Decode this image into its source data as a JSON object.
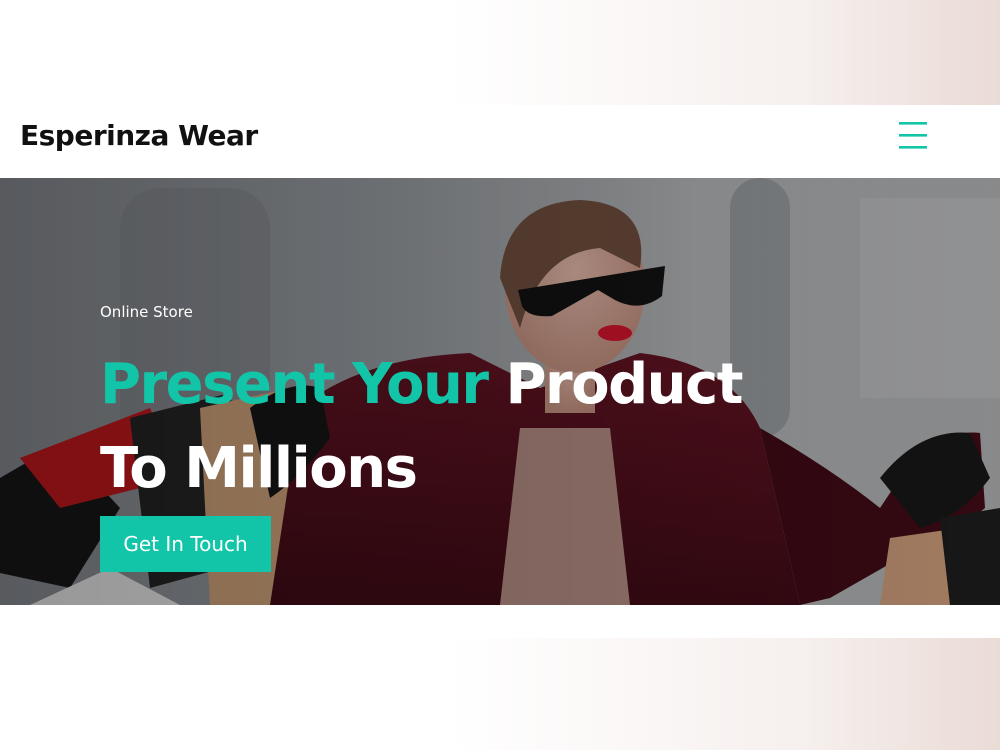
{
  "navbar": {
    "brand": "Esperinza Wear",
    "menu_icon": "hamburger-menu-icon"
  },
  "hero": {
    "eyebrow": "Online Store",
    "headline_accent": "Present Your",
    "headline_rest": "Product",
    "headline_line2": "To Millions",
    "cta_label": "Get In Touch",
    "image": "woman-with-shopping-bags-photo"
  },
  "colors": {
    "accent": "#13c5a8",
    "text_dark": "#111111",
    "text_light": "#ffffff"
  }
}
